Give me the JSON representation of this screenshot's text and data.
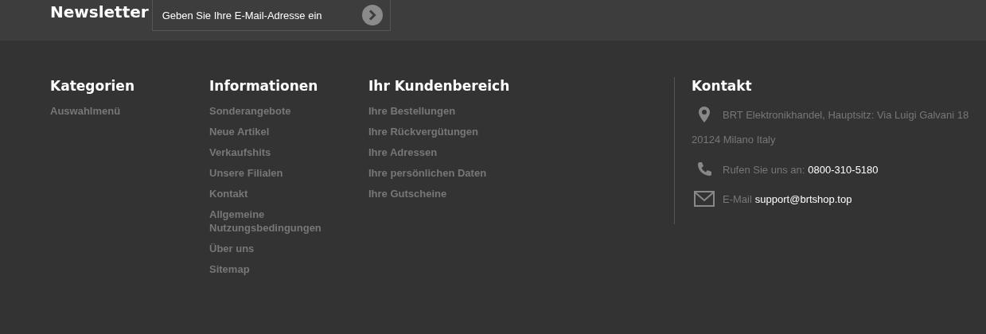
{
  "newsletter": {
    "title": "Newsletter",
    "email_field": {
      "placeholder": "Geben Sie Ihre E-Mail-Adresse ein"
    }
  },
  "columns": [
    {
      "title": "Kategorien",
      "links": [
        "Auswahlmenü"
      ]
    },
    {
      "title": "Informationen",
      "links": [
        "Sonderangebote",
        "Neue Artikel",
        "Verkaufshits",
        "Unsere Filialen",
        "Kontakt",
        "Allgemeine Nutzungsbedingungen",
        "Über uns",
        "Sitemap"
      ]
    },
    {
      "title": "Ihr Kundenbereich",
      "links": [
        "Ihre Bestellungen",
        "Ihre Rückvergütungen",
        "Ihre Adressen",
        "Ihre persönlichen Daten",
        "Ihre Gutscheine"
      ]
    }
  ],
  "contact": {
    "title": "Kontakt",
    "items": [
      {
        "kind": "address",
        "text": "BRT Elektronikhandel, Hauptsitz: Via Luigi Galvani 18",
        "continuation": "20124 Milano Italy"
      },
      {
        "kind": "phone",
        "label": "Rufen Sie uns an:",
        "value": "0800-310-5180"
      },
      {
        "kind": "email",
        "label": "E-Mail",
        "value": "support@brtshop.top"
      }
    ]
  }
}
